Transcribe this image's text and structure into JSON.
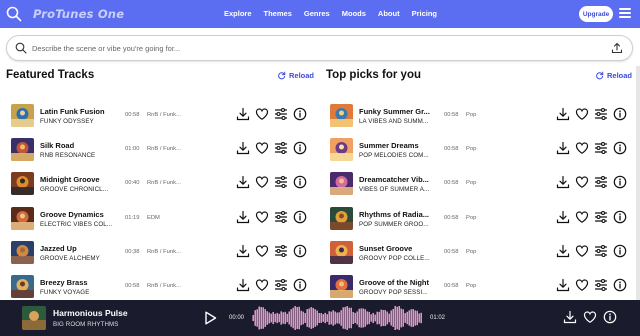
{
  "header": {
    "logo": "ProTunes One",
    "nav": [
      "Explore",
      "Themes",
      "Genres",
      "Moods",
      "About",
      "Pricing"
    ],
    "upgrade": "Upgrade"
  },
  "search": {
    "placeholder": "Describe the scene or vibe you're going for..."
  },
  "featured": {
    "title": "Featured Tracks",
    "reload": "Reload",
    "tracks": [
      {
        "name": "Latin Funk Fusion",
        "artist": "FUNKY ODYSSEY",
        "duration": "00:58",
        "genre": "RnB / Funk..."
      },
      {
        "name": "Silk Road",
        "artist": "RNB RESONANCE",
        "duration": "01:00",
        "genre": "RnB / Funk..."
      },
      {
        "name": "Midnight Groove",
        "artist": "GROOVE CHRONICL...",
        "duration": "00:40",
        "genre": "RnB / Funk..."
      },
      {
        "name": "Groove Dynamics",
        "artist": "ELECTRIC VIBES COL...",
        "duration": "01:19",
        "genre": "EDM"
      },
      {
        "name": "Jazzed Up",
        "artist": "GROOVE ALCHEMY",
        "duration": "00:38",
        "genre": "RnB / Funk..."
      },
      {
        "name": "Breezy Brass",
        "artist": "FUNKY VOYAGE",
        "duration": "00:58",
        "genre": "RnB / Funk..."
      }
    ]
  },
  "picks": {
    "title": "Top picks for you",
    "reload": "Reload",
    "tracks": [
      {
        "name": "Funky Summer Gr...",
        "artist": "LA VIBES AND SUMM...",
        "duration": "00:58",
        "genre": "Pop"
      },
      {
        "name": "Summer Dreams",
        "artist": "POP MELODIES COM...",
        "duration": "00:58",
        "genre": "Pop"
      },
      {
        "name": "Dreamcatcher Vib...",
        "artist": "VIBES OF SUMMER A...",
        "duration": "00:58",
        "genre": "Pop"
      },
      {
        "name": "Rhythms of Radia...",
        "artist": "POP SUMMER GROO...",
        "duration": "00:58",
        "genre": "Pop"
      },
      {
        "name": "Sunset Groove",
        "artist": "GROOVY POP COLLE...",
        "duration": "00:58",
        "genre": "Pop"
      },
      {
        "name": "Groove of the Night",
        "artist": "GROOVY POP SESSI...",
        "duration": "00:58",
        "genre": "Pop"
      }
    ]
  },
  "player": {
    "title": "Harmonious Pulse",
    "artist": "BIG ROOM RHYTHMS",
    "current": "00:00",
    "total": "01:02"
  },
  "colors": {
    "header": "#5b6ef2",
    "accent": "#3b4bd8",
    "player_bg": "#1a1c2e",
    "wave": "#f4a6d8"
  }
}
